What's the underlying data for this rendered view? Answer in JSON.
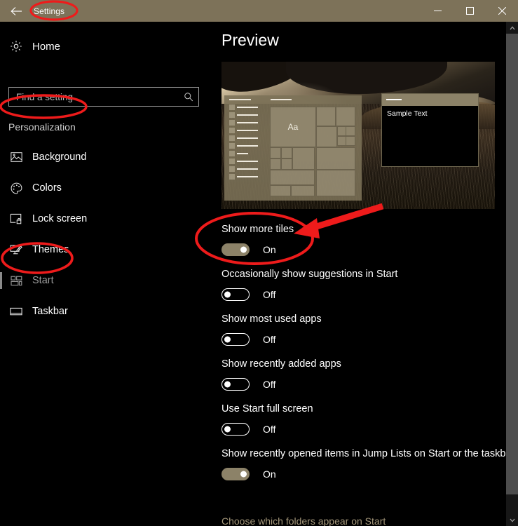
{
  "window": {
    "title": "Settings",
    "back_icon": "back-arrow-icon",
    "minimize_label": "Minimize",
    "maximize_label": "Maximize",
    "close_label": "Close",
    "accent_color": "#7d7259",
    "background_color": "#000000"
  },
  "sidebar": {
    "home": {
      "label": "Home",
      "icon": "gear-icon"
    },
    "search": {
      "placeholder": "Find a setting",
      "value": "",
      "icon": "search-icon"
    },
    "group_title": "Personalization",
    "items": [
      {
        "label": "Background",
        "icon": "picture-icon",
        "selected": false
      },
      {
        "label": "Colors",
        "icon": "palette-icon",
        "selected": false
      },
      {
        "label": "Lock screen",
        "icon": "lock-screen-icon",
        "selected": false
      },
      {
        "label": "Themes",
        "icon": "themes-icon",
        "selected": false
      },
      {
        "label": "Start",
        "icon": "start-tiles-icon",
        "selected": true
      },
      {
        "label": "Taskbar",
        "icon": "taskbar-icon",
        "selected": false
      }
    ]
  },
  "main": {
    "heading": "Preview",
    "preview": {
      "start_menu_tile_label": "Aa",
      "sample_window_text": "Sample Text"
    },
    "settings": [
      {
        "label": "Show more tiles",
        "state": "On",
        "on": true
      },
      {
        "label": "Occasionally show suggestions in Start",
        "state": "Off",
        "on": false
      },
      {
        "label": "Show most used apps",
        "state": "Off",
        "on": false
      },
      {
        "label": "Show recently added apps",
        "state": "Off",
        "on": false
      },
      {
        "label": "Use Start full screen",
        "state": "Off",
        "on": false
      },
      {
        "label": "Show recently opened items in Jump Lists on Start or the taskbar",
        "state": "On",
        "on": true
      },
      {
        "label": "Choose which folders appear on Start",
        "state": "",
        "on": null
      }
    ],
    "folder_link": "Choose which folders appear on Start",
    "link_color": "#a4977a"
  },
  "scrollbar": {
    "up_icon": "chevron-up-icon",
    "down_icon": "chevron-down-icon"
  },
  "annotations": {
    "color": "#ee1b1b",
    "ellipses": [
      "Settings",
      "Personalization",
      "Start",
      "Show more tiles"
    ],
    "arrow": "points to Show more tiles toggle"
  }
}
